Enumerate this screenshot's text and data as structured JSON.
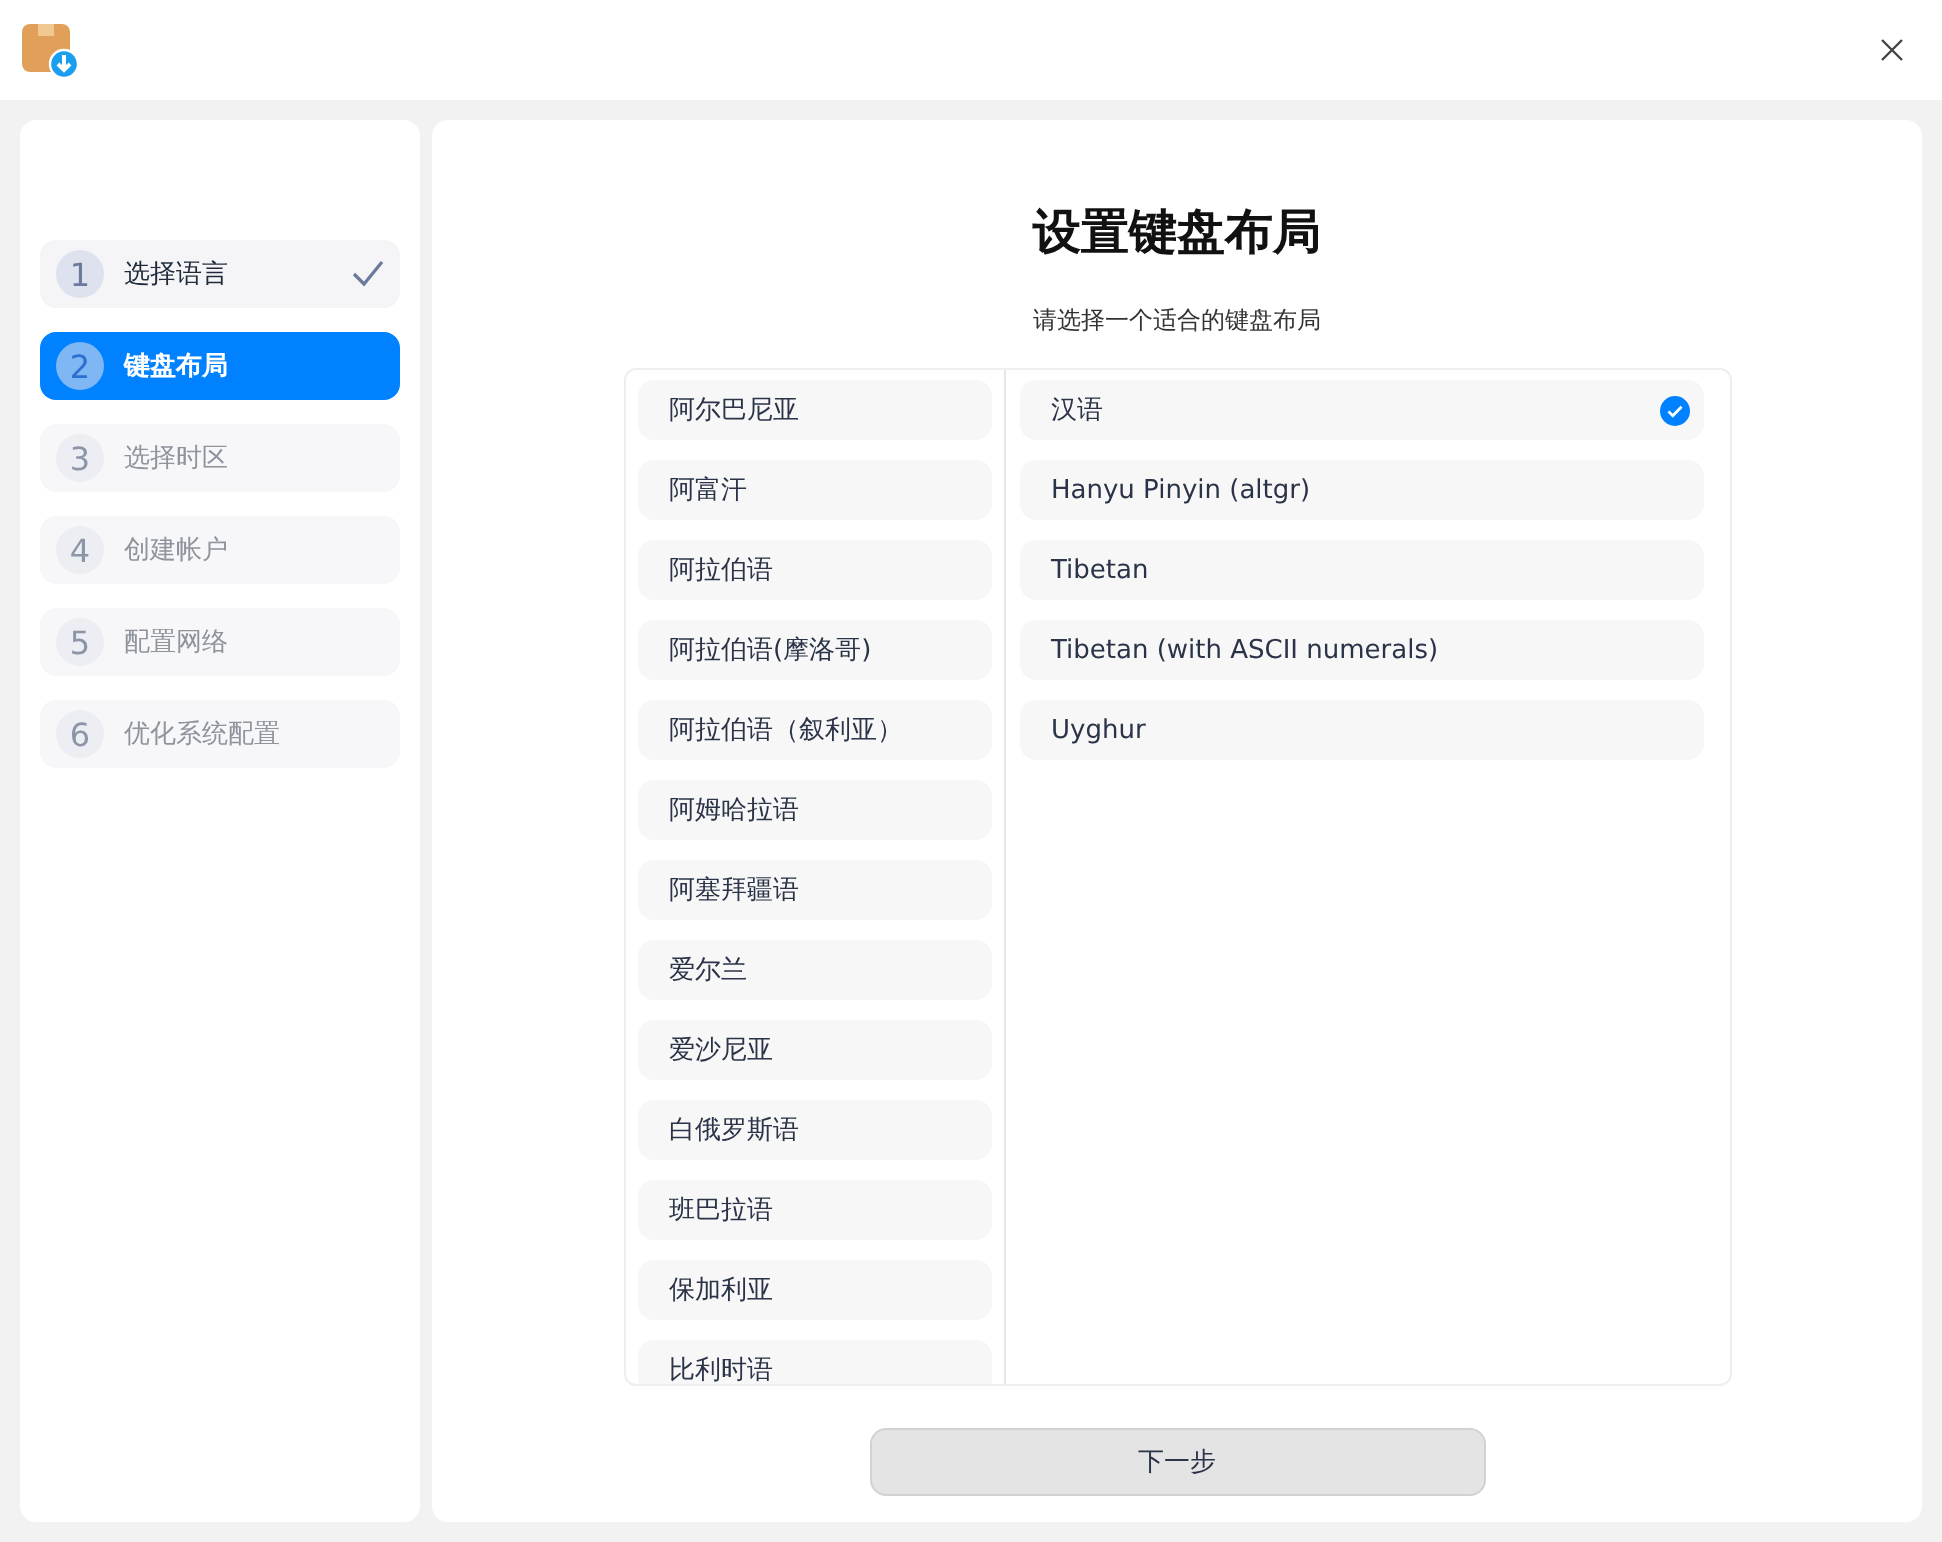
{
  "steps": [
    {
      "number": "1",
      "label": "选择语言",
      "kind": "done"
    },
    {
      "number": "2",
      "label": "键盘布局",
      "kind": "current"
    },
    {
      "number": "3",
      "label": "选择时区",
      "kind": "pending"
    },
    {
      "number": "4",
      "label": "创建帐户",
      "kind": "pending"
    },
    {
      "number": "5",
      "label": "配置网络",
      "kind": "pending"
    },
    {
      "number": "6",
      "label": "优化系统配置",
      "kind": "pending"
    }
  ],
  "title": "设置键盘布局",
  "subtitle": "请选择一个适合的键盘布局",
  "languages": [
    {
      "label": "阿尔巴尼亚"
    },
    {
      "label": "阿富汗"
    },
    {
      "label": "阿拉伯语"
    },
    {
      "label": "阿拉伯语(摩洛哥)"
    },
    {
      "label": "阿拉伯语（叙利亚）"
    },
    {
      "label": "阿姆哈拉语"
    },
    {
      "label": "阿塞拜疆语"
    },
    {
      "label": "爱尔兰"
    },
    {
      "label": "爱沙尼亚"
    },
    {
      "label": "白俄罗斯语"
    },
    {
      "label": "班巴拉语"
    },
    {
      "label": "保加利亚"
    },
    {
      "label": "比利时语"
    }
  ],
  "layouts": [
    {
      "label": "汉语",
      "selected": true
    },
    {
      "label": "Hanyu Pinyin (altgr)",
      "selected": false
    },
    {
      "label": "Tibetan",
      "selected": false
    },
    {
      "label": "Tibetan (with ASCII numerals)",
      "selected": false
    },
    {
      "label": "Uyghur",
      "selected": false
    }
  ],
  "next_button": "下一步"
}
